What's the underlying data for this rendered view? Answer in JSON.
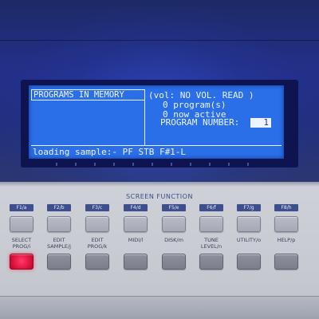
{
  "lcd": {
    "header": "PROGRAMS IN MEMORY",
    "vol_line": "(vol: NO VOL. READ )",
    "program_count_line": "0 program(s)",
    "active_line": "0 now active",
    "program_number_label": "PROGRAM NUMBER:",
    "program_number_value": "1",
    "status_line": "loading sample:- PF STB F#1-L"
  },
  "panel": {
    "section_title": "SCREEN FUNCTION",
    "fkeys": [
      "F1/a",
      "F2/b",
      "F3/c",
      "F4/d",
      "F5/e",
      "F6/f",
      "F7/g",
      "F8/h"
    ],
    "functions": [
      {
        "label": "SELECT\nPROG/i",
        "active": true
      },
      {
        "label": "EDIT\nSAMPLE/j",
        "active": false
      },
      {
        "label": "EDIT\nPROG/k",
        "active": false
      },
      {
        "label": "MIDI/l",
        "active": false
      },
      {
        "label": "DISK/m",
        "active": false
      },
      {
        "label": "TUNE\nLEVEL/n",
        "active": false
      },
      {
        "label": "UTILITY/o",
        "active": false
      },
      {
        "label": "HELP/p",
        "active": false
      }
    ]
  },
  "colors": {
    "lcd_background": "#2a6fe8",
    "lcd_text": "#eef4ff",
    "housing": "#23308a",
    "panel": "#c9cbd3",
    "fkey_label_bg": "#3d4f8c",
    "active_led": "#e0143f"
  }
}
